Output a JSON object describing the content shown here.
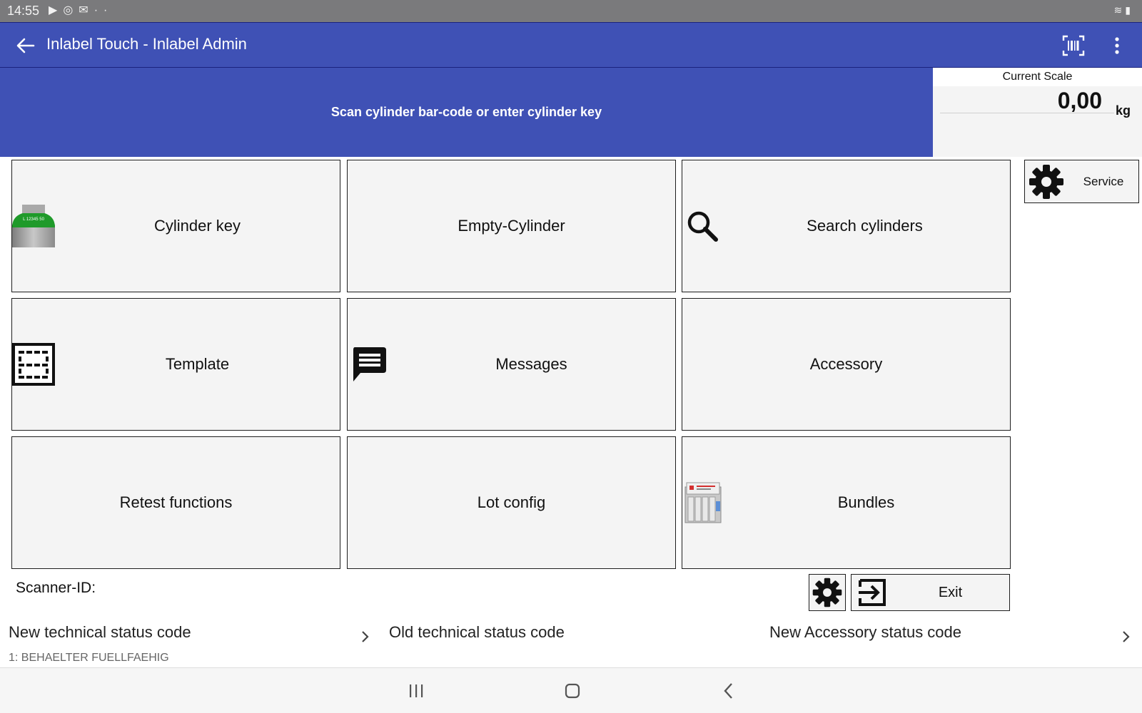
{
  "status_bar": {
    "time": "14:55",
    "icons": [
      "play-store-icon",
      "sync-icon",
      "mail-icon",
      "more-dots-icon"
    ],
    "right_icons": [
      "wifi-icon",
      "battery-icon"
    ]
  },
  "app_bar": {
    "title": "Inlabel Touch -  Inlabel Admin",
    "color": "#3f51b5"
  },
  "prompt": {
    "text": "Scan cylinder bar-code or enter cylinder key"
  },
  "scale": {
    "label": "Current Scale",
    "value": "0,00",
    "unit": "kg"
  },
  "tiles": [
    {
      "label": "Cylinder key",
      "icon": "cylinder-image"
    },
    {
      "label": "Empty-Cylinder"
    },
    {
      "label": "Search cylinders",
      "icon": "search-icon"
    },
    {
      "label": "Template",
      "icon": "template-icon"
    },
    {
      "label": "Messages",
      "icon": "message-icon"
    },
    {
      "label": "Accessory"
    },
    {
      "label": "Retest functions"
    },
    {
      "label": "Lot config"
    },
    {
      "label": "Bundles",
      "icon": "bundle-image"
    }
  ],
  "service": {
    "label": "Service"
  },
  "scanner": {
    "label": "Scanner-ID:"
  },
  "exit": {
    "label": "Exit"
  },
  "status_codes": {
    "new_technical": {
      "title": "New technical status code",
      "value": "1: BEHAELTER FUELLFAEHIG"
    },
    "old_technical": {
      "title": "Old technical status code"
    },
    "new_accessory": {
      "title": "New Accessory status code"
    }
  },
  "cylinder_label": "L 12345 50"
}
